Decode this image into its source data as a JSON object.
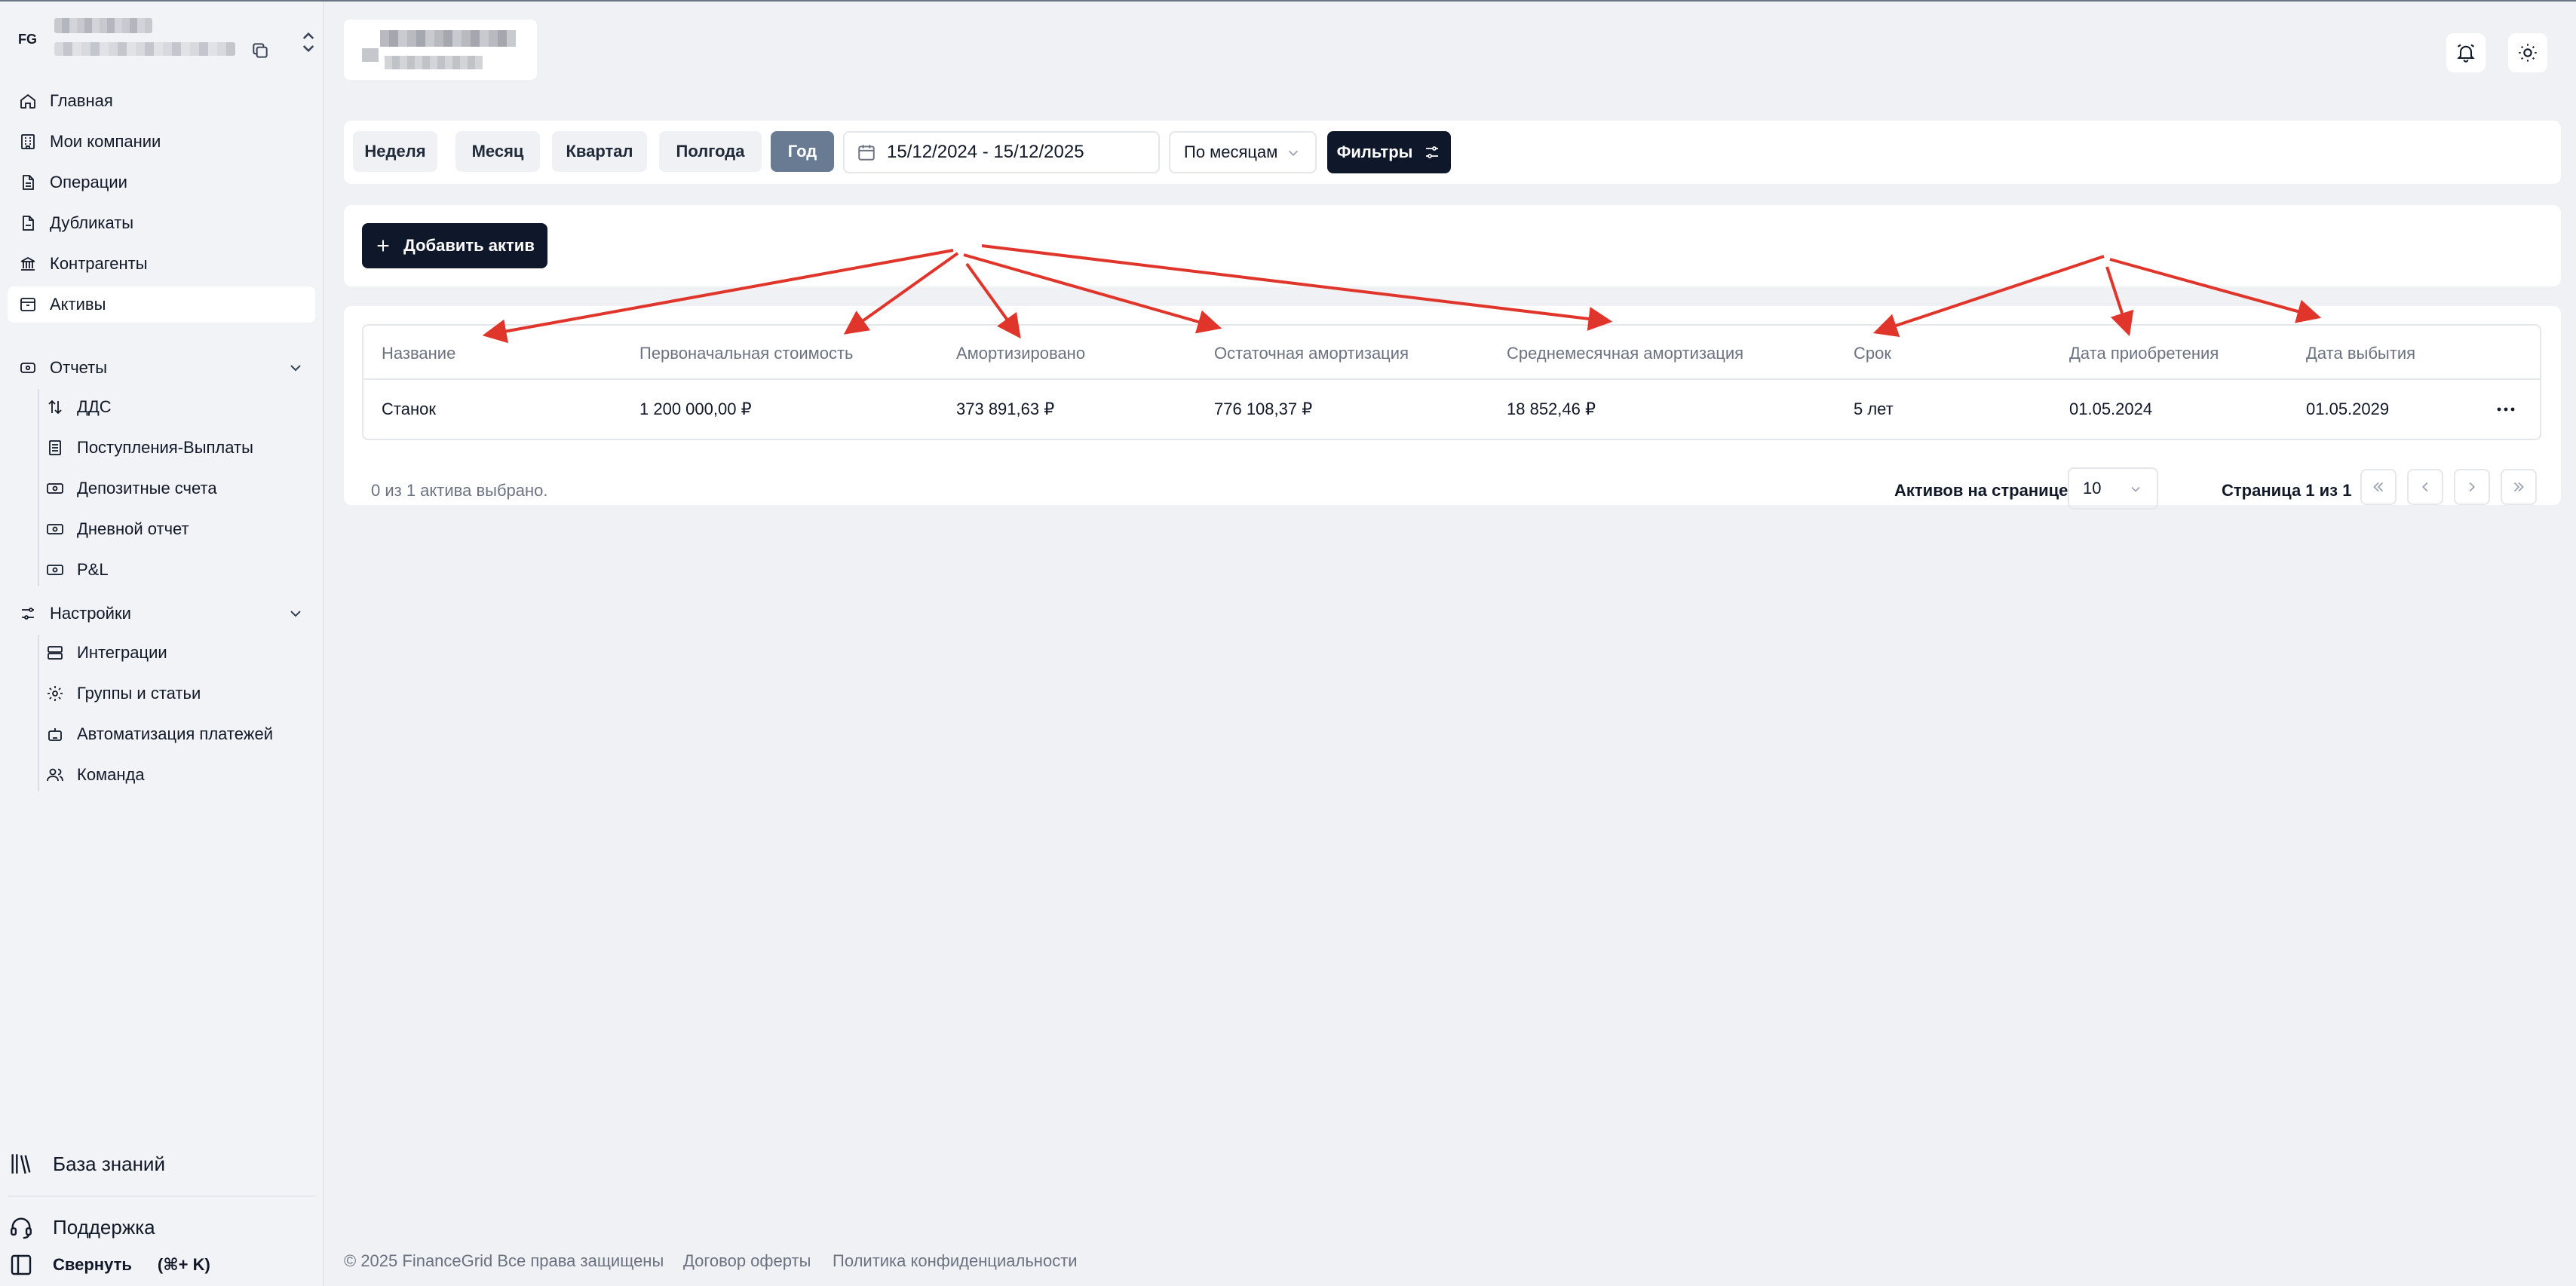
{
  "org": {
    "initials": "FG"
  },
  "sidebar": {
    "items": [
      {
        "label": "Главная",
        "icon": "home-icon"
      },
      {
        "label": "Мои компании",
        "icon": "building-icon"
      },
      {
        "label": "Операции",
        "icon": "document-icon"
      },
      {
        "label": "Дубликаты",
        "icon": "document-duplicate-icon"
      },
      {
        "label": "Контрагенты",
        "icon": "bank-icon"
      },
      {
        "label": "Активы",
        "icon": "archive-icon",
        "active": true
      }
    ],
    "reports": {
      "label": "Отчеты",
      "icon": "wallet-icon",
      "children": [
        {
          "label": "ДДС",
          "icon": "arrows-updown-icon"
        },
        {
          "label": "Поступления-Выплаты",
          "icon": "list-icon"
        },
        {
          "label": "Депозитные счета",
          "icon": "banknote-icon"
        },
        {
          "label": "Дневной отчет",
          "icon": "banknote-icon"
        },
        {
          "label": "P&L",
          "icon": "banknote-icon"
        }
      ]
    },
    "settings": {
      "label": "Настройки",
      "icon": "sliders-icon",
      "children": [
        {
          "label": "Интеграции",
          "icon": "server-icon"
        },
        {
          "label": "Группы и статьи",
          "icon": "gear-icon"
        },
        {
          "label": "Автоматизация платежей",
          "icon": "robot-icon"
        },
        {
          "label": "Команда",
          "icon": "users-icon"
        }
      ]
    },
    "bottom": {
      "knowledge": "База знаний",
      "support": "Поддержка",
      "collapse": "Свернуть",
      "collapse_shortcut": "(⌘+ K)"
    }
  },
  "toolbar": {
    "periods": [
      "Неделя",
      "Месяц",
      "Квартал",
      "Полгода",
      "Год"
    ],
    "active_period": "Год",
    "date_range": "15/12/2024 - 15/12/2025",
    "grouping": "По месяцам",
    "filters_label": "Фильтры"
  },
  "assets": {
    "add_label": "Добавить актив",
    "columns": [
      "Название",
      "Первоначальная стоимость",
      "Амортизировано",
      "Остаточная амортизация",
      "Среднемесячная амортизация",
      "Срок",
      "Дата приобретения",
      "Дата выбытия"
    ],
    "rows": [
      [
        "Станок",
        "1 200 000,00 ₽",
        "373 891,63 ₽",
        "776 108,37 ₽",
        "18 852,46 ₽",
        "5 лет",
        "01.05.2024",
        "01.05.2029"
      ]
    ],
    "selection_text": "0 из 1 актива выбрано.",
    "per_page_label": "Активов на странице",
    "per_page_value": "10",
    "page_info": "Страница 1 из 1"
  },
  "footer": {
    "copyright": "© 2025 FinanceGrid Все права защищены",
    "offer": "Договор оферты",
    "privacy": "Политика конфиденциальности"
  },
  "colors": {
    "accent_dark": "#0f172a",
    "active_period": "#697a93",
    "annotation_arrow": "#e0352b",
    "background": "#eff1f5"
  }
}
